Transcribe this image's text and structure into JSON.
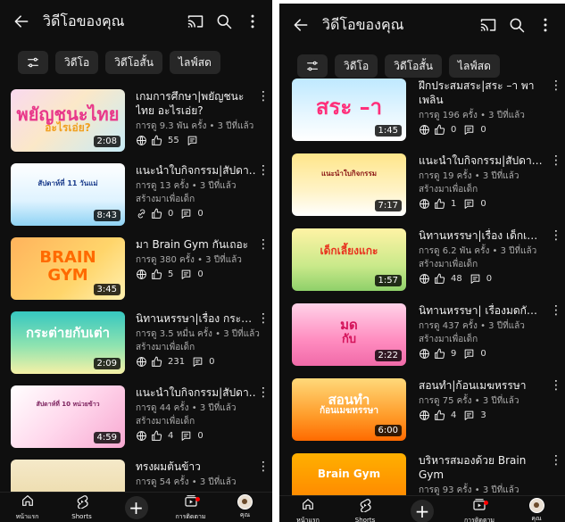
{
  "colors": {
    "background": "#0f0f0f",
    "chip": "#272727",
    "text": "#f1f1f1",
    "secondary": "#aaaaaa",
    "accent": "#ff0000"
  },
  "left": {
    "header": {
      "title": "วิดีโอของคุณ"
    },
    "chips": [
      "วิดีโอ",
      "วิดีโอสั้น",
      "ไลฟ์สด"
    ],
    "videos": [
      {
        "title_line1": "เกมการศึกษา|พยัญชนะ",
        "title_line2": "ไทย อะไรเอ่ย?",
        "stats": "การดู 9.3 พัน ครั้ง • 3 ปีที่แล้ว",
        "sub": "",
        "likes": "55",
        "comments": "",
        "duration": "2:08",
        "thumb_line1": "พยัญชนะไทย",
        "thumb_line2": "อะไรเอ่ย?",
        "thumb_icon": "globe-icon"
      },
      {
        "title_line1": "แนะนำใบกิจกรรม|สัปดา…",
        "title_line2": "",
        "stats": "การดู 13 ครั้ง • 3 ปีที่แล้ว",
        "sub": "สร้างมาเพื่อเด็ก",
        "likes": "0",
        "comments": "0",
        "duration": "8:43",
        "thumb_line1": "สัปดาห์ที่ 11 วันแม่",
        "thumb_line2": "",
        "thumb_icon": "link-icon"
      },
      {
        "title_line1": "มา Brain Gym กันเถอะ",
        "title_line2": "",
        "stats": "การดู 380 ครั้ง • 3 ปีที่แล้ว",
        "sub": "",
        "likes": "5",
        "comments": "0",
        "duration": "3:45",
        "thumb_line1": "BRAIN",
        "thumb_line2": "GYM",
        "thumb_icon": "globe-icon"
      },
      {
        "title_line1": "นิทานหรรษา|เรื่อง กระ…",
        "title_line2": "",
        "stats": "การดู 3.5 หมื่น ครั้ง • 3 ปีที่แล้ว",
        "sub": "สร้างมาเพื่อเด็ก",
        "likes": "231",
        "comments": "0",
        "duration": "2:09",
        "thumb_line1": "กระต่ายกับเต่า",
        "thumb_line2": "",
        "thumb_icon": "globe-icon"
      },
      {
        "title_line1": "แนะนำใบกิจกรรม|สัปดา…",
        "title_line2": "",
        "stats": "การดู 44 ครั้ง • 3 ปีที่แล้ว",
        "sub": "สร้างมาเพื่อเด็ก",
        "likes": "4",
        "comments": "0",
        "duration": "4:59",
        "thumb_line1": "สัปดาห์ที่ 10 หน่วยข้าว",
        "thumb_line2": "",
        "thumb_icon": "globe-icon"
      },
      {
        "title_line1": "ทรงผมต้นข้าว",
        "title_line2": "",
        "stats": "การดู 54 ครั้ง • 3 ปีที่แล้ว",
        "sub": "",
        "likes": "",
        "comments": "",
        "duration": "",
        "thumb_line1": "",
        "thumb_line2": "",
        "thumb_icon": ""
      }
    ],
    "nav": {
      "home": "หน้าแรก",
      "shorts": "Shorts",
      "subscriptions": "การติดตาม",
      "you": "คุณ"
    }
  },
  "right": {
    "header": {
      "title": "วิดีโอของคุณ"
    },
    "chips": [
      "วิดีโอ",
      "วิดีโอสั้น",
      "ไลฟ์สด"
    ],
    "videos": [
      {
        "title_line1": "ฝึกประสมสระ|สระ –า พา",
        "title_line2": "เพลิน",
        "stats": "การดู 196 ครั้ง • 3 ปีที่แล้ว",
        "sub": "",
        "likes": "0",
        "comments": "0",
        "duration": "1:45",
        "thumb_line1": "สระ –า",
        "thumb_line2": "",
        "thumb_icon": "globe-icon"
      },
      {
        "title_line1": "แนะนำใบกิจกรรม|สัปดา…",
        "title_line2": "",
        "stats": "การดู 19 ครั้ง • 3 ปีที่แล้ว",
        "sub": "สร้างมาเพื่อเด็ก",
        "likes": "1",
        "comments": "0",
        "duration": "7:17",
        "thumb_line1": "แนะนำใบกิจกรรม",
        "thumb_line2": "",
        "thumb_icon": "globe-icon"
      },
      {
        "title_line1": "นิทานหรรษา|เรื่อง เด็กเ…",
        "title_line2": "",
        "stats": "การดู 6.2 พัน ครั้ง • 3 ปีที่แล้ว",
        "sub": "สร้างมาเพื่อเด็ก",
        "likes": "48",
        "comments": "0",
        "duration": "1:57",
        "thumb_line1": "เด็กเลี้ยงแกะ",
        "thumb_line2": "",
        "thumb_icon": "globe-icon"
      },
      {
        "title_line1": "นิทานหรรษา| เรื่องมดกั…",
        "title_line2": "",
        "stats": "การดู 437 ครั้ง • 3 ปีที่แล้ว",
        "sub": "สร้างมาเพื่อเด็ก",
        "likes": "9",
        "comments": "0",
        "duration": "2:22",
        "thumb_line1": "มด",
        "thumb_line2": "กับ",
        "thumb_icon": "globe-icon"
      },
      {
        "title_line1": "สอนทำ|ก้อนเมฆหรรษา",
        "title_line2": "",
        "stats": "การดู 75 ครั้ง • 3 ปีที่แล้ว",
        "sub": "",
        "likes": "4",
        "comments": "3",
        "duration": "6:00",
        "thumb_line1": "สอนทำ",
        "thumb_line2": "ก้อนเมฆหรรษา",
        "thumb_icon": "globe-icon"
      },
      {
        "title_line1": "บริหารสมองด้วย Brain",
        "title_line2": "Gym",
        "stats": "การดู 93 ครั้ง • 3 ปีที่แล้ว",
        "sub": "",
        "likes": "",
        "comments": "",
        "duration": "",
        "thumb_line1": "Brain Gym",
        "thumb_line2": "",
        "thumb_icon": ""
      }
    ],
    "nav": {
      "home": "หน้าแรก",
      "shorts": "Shorts",
      "subscriptions": "การติดตาม",
      "you": "คุณ"
    }
  }
}
